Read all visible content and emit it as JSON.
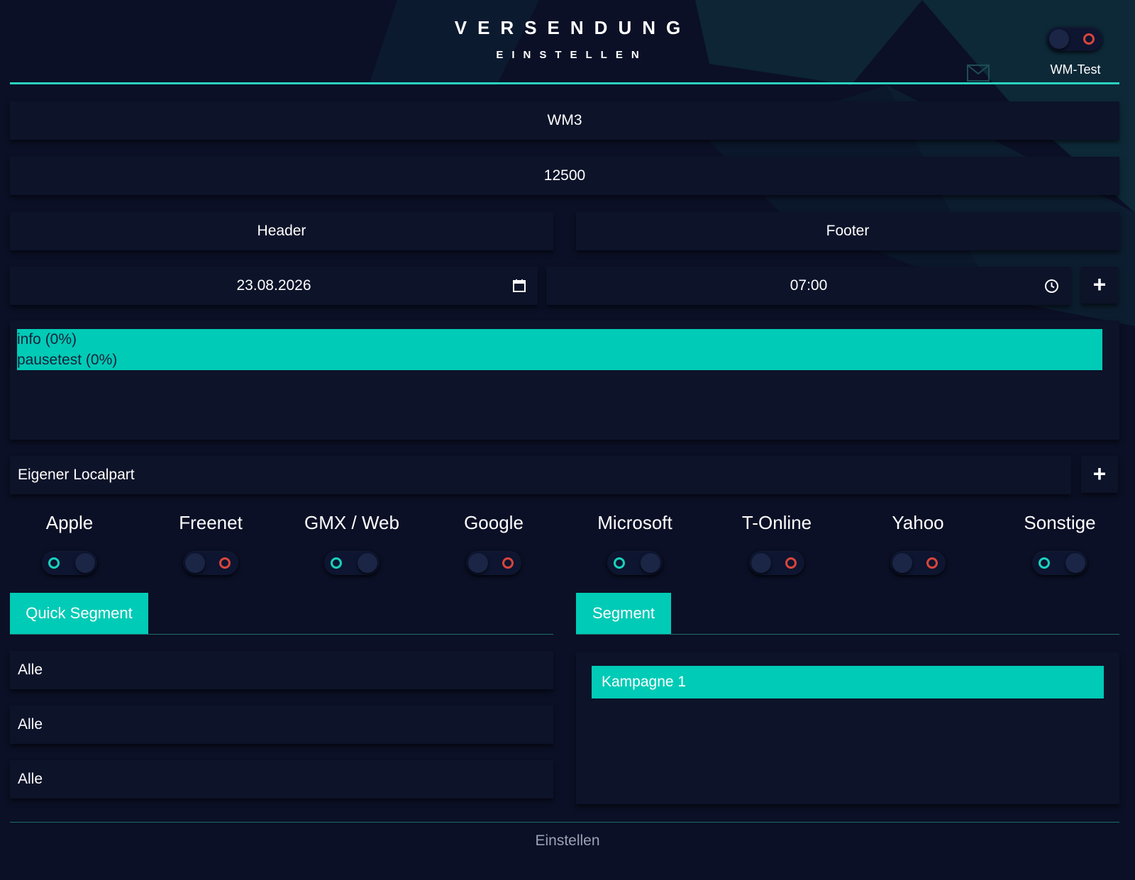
{
  "header": {
    "title": "VERSENDUNG",
    "subtitle": "EINSTELLEN",
    "wm_test_label": "WM-Test",
    "wm_test_on": false
  },
  "form": {
    "server": "WM3",
    "amount": "12500",
    "header_label": "Header",
    "footer_label": "Footer",
    "date": "23.08.2026",
    "time": "07:00"
  },
  "list": {
    "selected": [
      "info (0%)",
      "pausetest (0%)"
    ]
  },
  "localpart": {
    "label": "Eigener Localpart"
  },
  "providers": [
    {
      "name": "Apple",
      "on": true
    },
    {
      "name": "Freenet",
      "on": false
    },
    {
      "name": "GMX / Web",
      "on": true
    },
    {
      "name": "Google",
      "on": false
    },
    {
      "name": "Microsoft",
      "on": true
    },
    {
      "name": "T-Online",
      "on": false
    },
    {
      "name": "Yahoo",
      "on": false
    },
    {
      "name": "Sonstige",
      "on": true
    }
  ],
  "tabs": {
    "quick_segment": "Quick Segment",
    "segment": "Segment"
  },
  "quick_segment_rows": [
    "Alle",
    "Alle",
    "Alle"
  ],
  "segments": [
    "Kampagne 1"
  ],
  "actions": {
    "submit": "Einstellen"
  },
  "colors": {
    "accent": "#00cbb6",
    "background": "#0b1026",
    "toggle_off_indicator": "#d9453b"
  }
}
